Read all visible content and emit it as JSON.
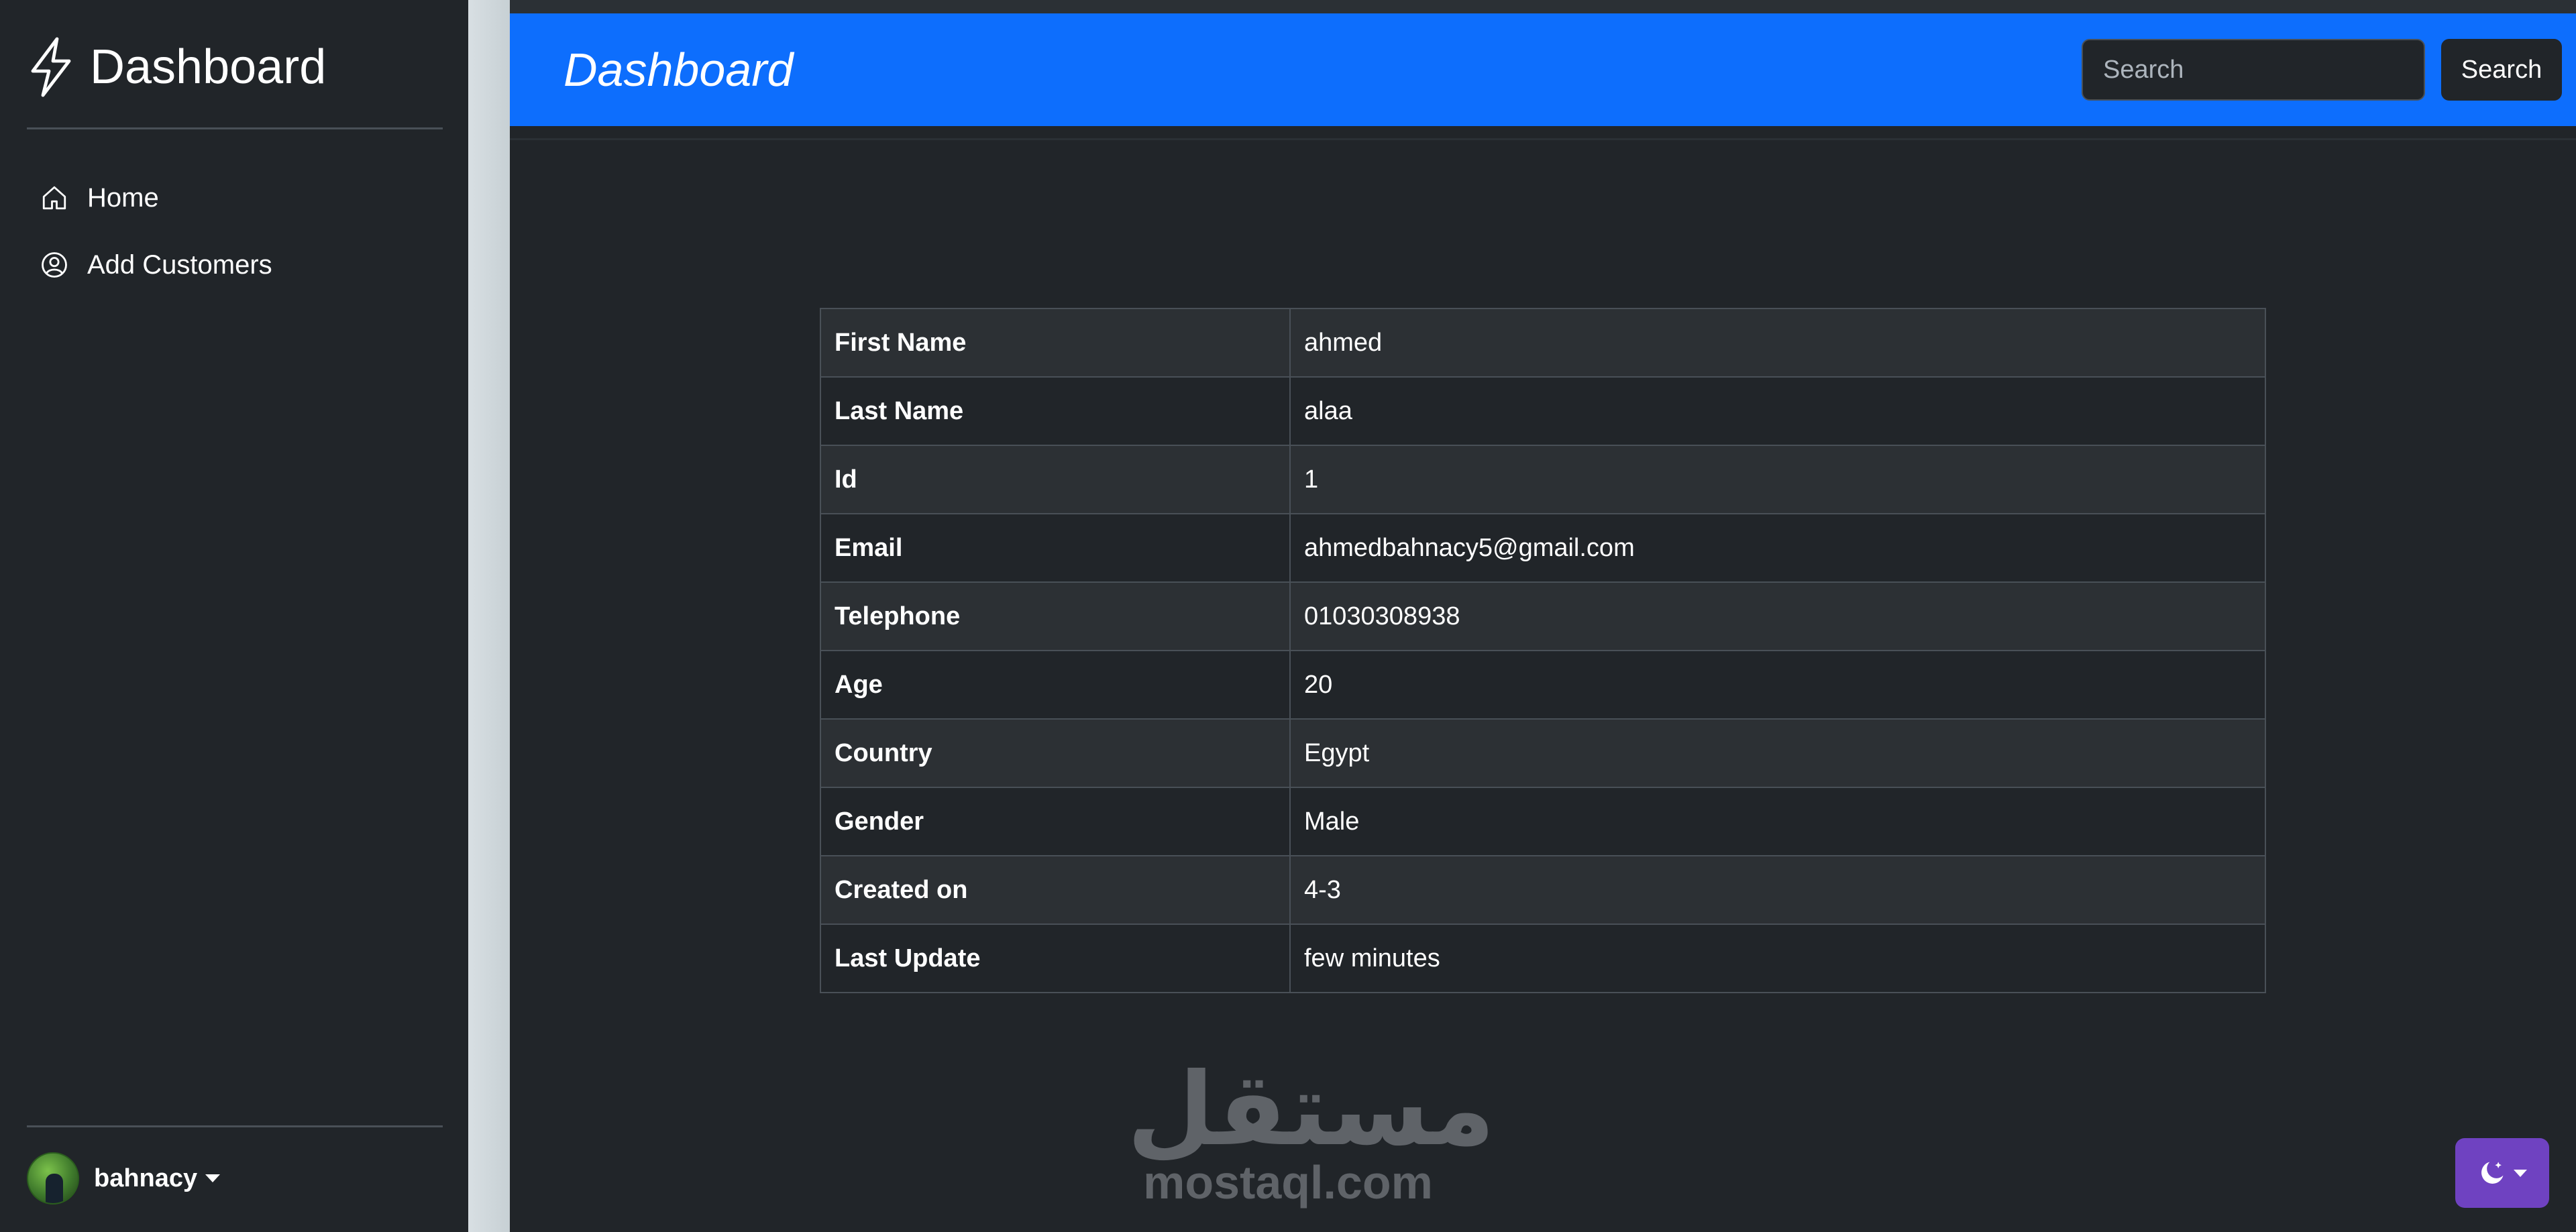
{
  "sidebar": {
    "brand": "Dashboard",
    "items": [
      {
        "label": "Home",
        "icon": "house-icon"
      },
      {
        "label": "Add Customers",
        "icon": "person-circle-icon"
      }
    ],
    "user": {
      "name": "bahnacy"
    }
  },
  "header": {
    "title": "Dashboard",
    "search_placeholder": "Search",
    "search_button": "Search",
    "color": "#0d6efd"
  },
  "customer": {
    "rows": [
      {
        "label": "First Name",
        "value": "ahmed"
      },
      {
        "label": "Last Name",
        "value": "alaa"
      },
      {
        "label": "Id",
        "value": "1"
      },
      {
        "label": "Email",
        "value": "ahmedbahnacy5@gmail.com"
      },
      {
        "label": "Telephone",
        "value": "01030308938"
      },
      {
        "label": "Age",
        "value": "20"
      },
      {
        "label": "Country",
        "value": "Egypt"
      },
      {
        "label": "Gender",
        "value": "Male"
      },
      {
        "label": "Created on",
        "value": "4-3"
      },
      {
        "label": "Last Update",
        "value": "few minutes"
      }
    ]
  },
  "watermark": {
    "arabic": "مستقل",
    "latin": "mostaql.com"
  },
  "theme_toggle": {
    "icon": "moon-stars-icon",
    "color": "#6f42c1"
  }
}
